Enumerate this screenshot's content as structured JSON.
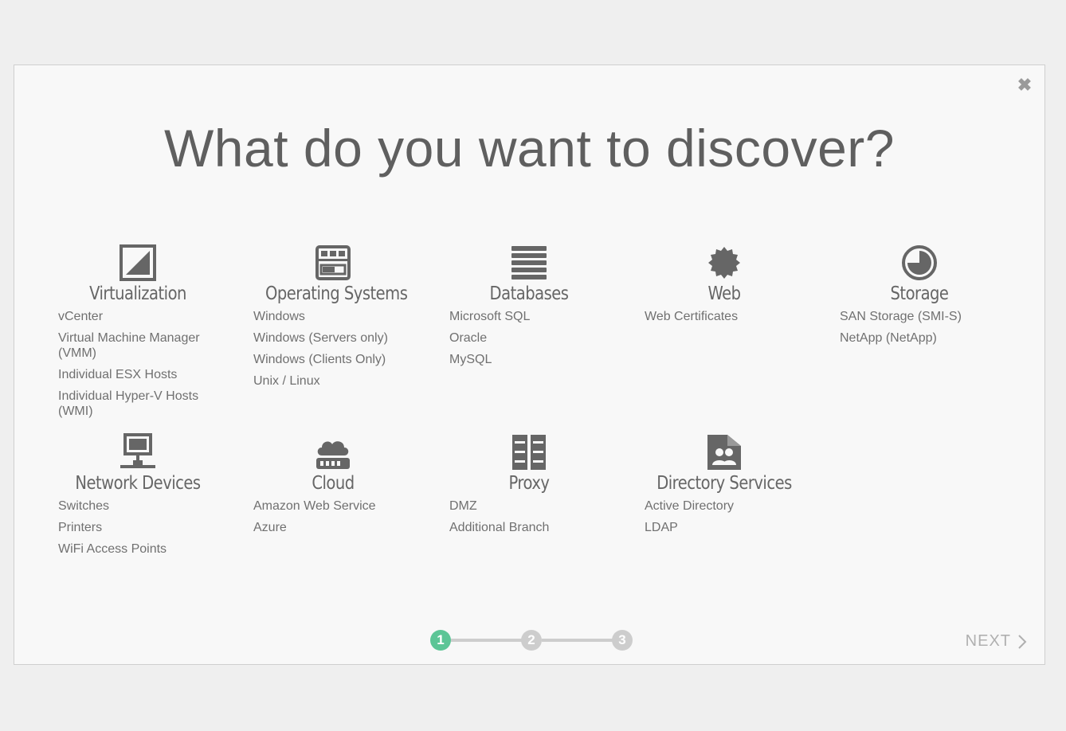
{
  "dialog": {
    "title": "What do you want to discover?",
    "close_icon": "close-icon",
    "next_label": "NEXT",
    "steps": [
      "1",
      "2",
      "3"
    ],
    "active_step": 1,
    "accent_color": "#5cc596"
  },
  "categories": [
    {
      "label": "Virtualization",
      "icon": "virtualization-icon",
      "items": [
        "vCenter",
        "Virtual Machine Manager\n(VMM)",
        "Individual ESX Hosts",
        "Individual Hyper-V Hosts\n(WMI)"
      ]
    },
    {
      "label": "Operating Systems",
      "icon": "operating-systems-icon",
      "items": [
        "Windows",
        "Windows (Servers only)",
        "Windows (Clients Only)",
        "Unix / Linux"
      ]
    },
    {
      "label": "Databases",
      "icon": "database-icon",
      "items": [
        "Microsoft SQL",
        "Oracle",
        "MySQL"
      ]
    },
    {
      "label": "Web",
      "icon": "certificate-badge-icon",
      "items": [
        "Web Certificates"
      ]
    },
    {
      "label": "Storage",
      "icon": "storage-disk-icon",
      "items": [
        "SAN Storage (SMI-S)",
        "NetApp (NetApp)"
      ]
    },
    {
      "label": "Network Devices",
      "icon": "network-device-icon",
      "items": [
        "Switches",
        "Printers",
        "WiFi Access Points"
      ]
    },
    {
      "label": "Cloud",
      "icon": "cloud-server-icon",
      "items": [
        "Amazon Web Service",
        "Azure"
      ]
    },
    {
      "label": "Proxy",
      "icon": "proxy-server-icon",
      "items": [
        "DMZ",
        "Additional Branch"
      ]
    },
    {
      "label": "Directory Services",
      "icon": "directory-folder-icon",
      "items": [
        "Active Directory",
        "LDAP"
      ]
    }
  ]
}
